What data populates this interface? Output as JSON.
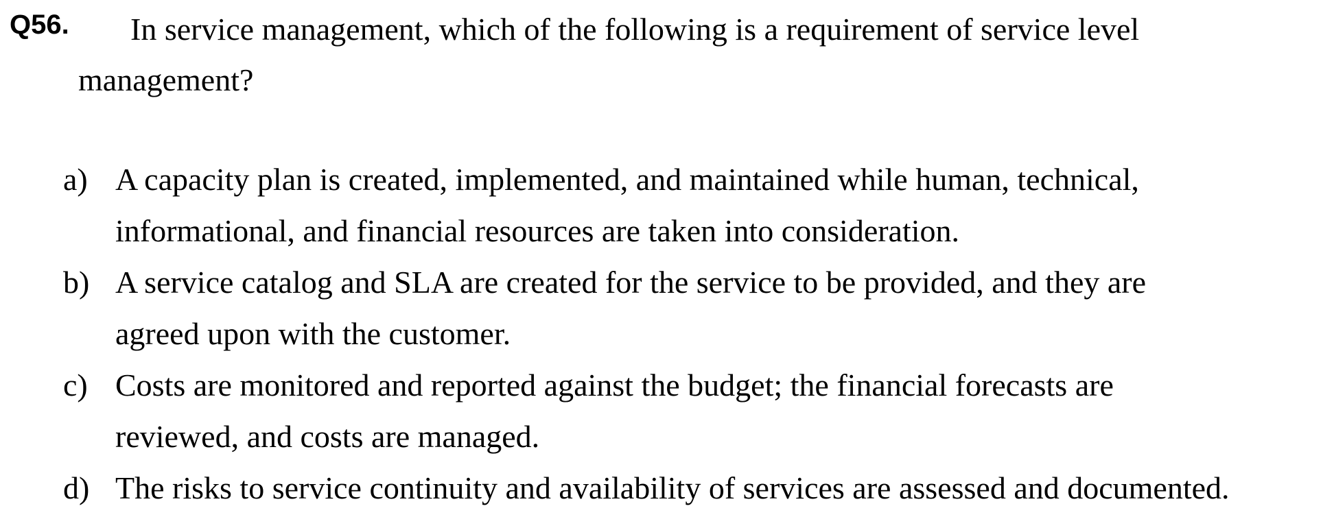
{
  "question": {
    "number": "Q56.",
    "stem_line1": "In service management, which of the following is a requirement of service level",
    "stem_line2": "management?"
  },
  "options": [
    {
      "letter": "a)",
      "line1": "A capacity plan is created, implemented, and maintained while human, technical,",
      "line2": "informational, and financial resources are taken into consideration."
    },
    {
      "letter": "b)",
      "line1": "A service catalog and SLA are created for the service to be provided, and they are",
      "line2": "agreed upon with the customer."
    },
    {
      "letter": "c)",
      "line1": "Costs are monitored and reported against the budget; the financial forecasts are",
      "line2": "reviewed, and costs are managed."
    },
    {
      "letter": "d)",
      "line1": "The risks to service continuity and availability of services are assessed and documented.",
      "line2": ""
    }
  ]
}
